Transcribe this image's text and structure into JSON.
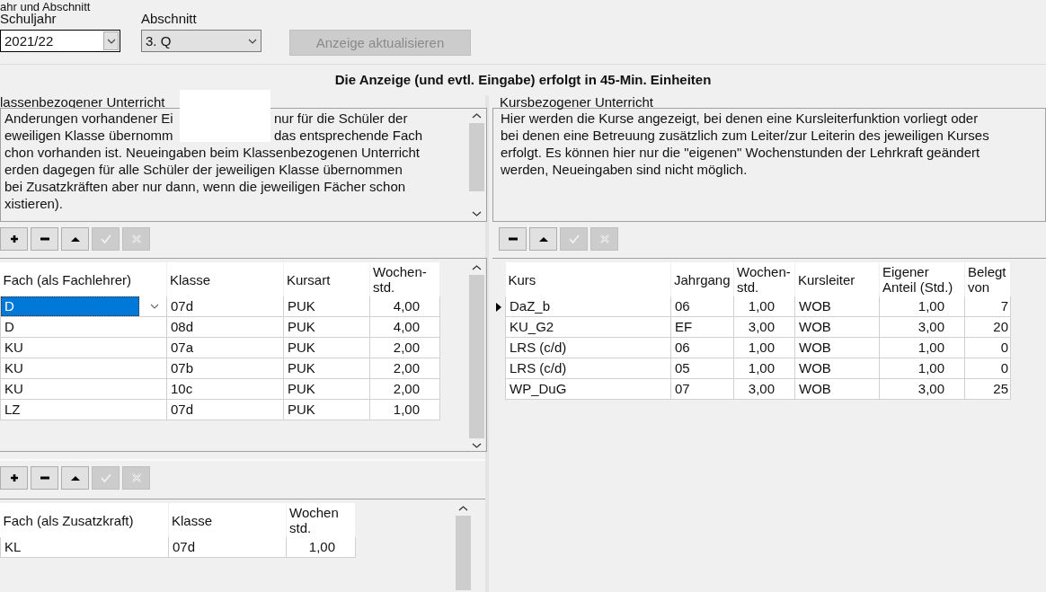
{
  "group_label": "ahr und Abschnitt",
  "fields": [
    {
      "label": "Schuljahr",
      "value": "2021/22",
      "focused": true
    },
    {
      "label": "Abschnitt",
      "value": "3. Q",
      "focused": false
    }
  ],
  "refresh_button": {
    "label": "Anzeige aktualisieren",
    "disabled": true
  },
  "heading": "Die Anzeige (und evtl. Eingabe) erfolgt in 45-Min. Einheiten",
  "class_panel": {
    "title": "lassenbezogener Unterricht",
    "description": [
      [
        "Anderungen vorhandener Ei",
        "nur für die Schüler der"
      ],
      [
        "eweiligen Klasse übernomm",
        "das entsprechende Fach"
      ],
      [
        "chon vorhanden ist. Neueingaben beim Klassenbezogenen Unterricht"
      ],
      [
        "erden dagegen für alle Schüler der jeweiligen Klasse übernommen"
      ],
      [
        "bei Zusatzkräften aber nur dann, wenn die jeweiligen Fächer schon"
      ],
      [
        "xistieren)."
      ]
    ],
    "toolbar": [
      {
        "kind": "plus",
        "disabled": false
      },
      {
        "kind": "minus",
        "disabled": false
      },
      {
        "kind": "up",
        "disabled": false
      },
      {
        "kind": "check",
        "disabled": true
      },
      {
        "kind": "cross",
        "disabled": true
      }
    ],
    "table": {
      "columns": [
        {
          "label": "Fach (als Fachlehrer)"
        },
        {
          "label": "Klasse"
        },
        {
          "label": "Kursart"
        },
        {
          "label": "Wochen-\nstd."
        }
      ],
      "rows": [
        {
          "cells": [
            "D",
            "07d",
            "PUK",
            "4,00"
          ],
          "selected": true
        },
        {
          "cells": [
            "D",
            "08d",
            "PUK",
            "4,00"
          ],
          "selected": false
        },
        {
          "cells": [
            "KU",
            "07a",
            "PUK",
            "2,00"
          ],
          "selected": false
        },
        {
          "cells": [
            "KU",
            "07b",
            "PUK",
            "2,00"
          ],
          "selected": false
        },
        {
          "cells": [
            "KU",
            "10c",
            "PUK",
            "2,00"
          ],
          "selected": false
        },
        {
          "cells": [
            "LZ",
            "07d",
            "PUK",
            "1,00"
          ],
          "selected": false
        }
      ]
    },
    "toolbar_2": [
      {
        "kind": "plus",
        "disabled": false
      },
      {
        "kind": "minus",
        "disabled": false
      },
      {
        "kind": "up",
        "disabled": false
      },
      {
        "kind": "check",
        "disabled": true
      },
      {
        "kind": "cross",
        "disabled": true
      }
    ],
    "table_2": {
      "columns": [
        {
          "label": "Fach (als Zusatzkraft)"
        },
        {
          "label": "Klasse"
        },
        {
          "label": "Wochen\nstd."
        }
      ],
      "rows": [
        {
          "cells": [
            "KL",
            "07d",
            "1,00"
          ],
          "selected": false
        }
      ]
    }
  },
  "course_panel": {
    "title": "Kursbezogener Unterricht",
    "description": [
      [
        "Hier werden die Kurse angezeigt, bei denen eine Kursleiterfunktion vorliegt oder"
      ],
      [
        "bei denen eine Betreuung zusätzlich zum Leiter/zur Leiterin des jeweiligen Kurses"
      ],
      [
        "erfolgt. Es können hier nur die \"eigenen\" Wochenstunden der Lehrkraft geändert"
      ],
      [
        "werden, Neueingaben sind nicht möglich."
      ]
    ],
    "toolbar": [
      {
        "kind": "minus",
        "disabled": false
      },
      {
        "kind": "up",
        "disabled": false
      },
      {
        "kind": "check",
        "disabled": true
      },
      {
        "kind": "cross",
        "disabled": true
      }
    ],
    "table": {
      "columns": [
        {
          "label": "Kurs"
        },
        {
          "label": "Jahrgang"
        },
        {
          "label": "Wochen-\nstd."
        },
        {
          "label": "Kursleiter"
        },
        {
          "label": "Eigener\nAnteil (Std.)"
        },
        {
          "label": "Belegt\nvon"
        }
      ],
      "rows": [
        {
          "cells": [
            "DaZ_b",
            "06",
            "1,00",
            "WOB",
            "1,00",
            "7"
          ],
          "selected": true
        },
        {
          "cells": [
            "KU_G2",
            "EF",
            "3,00",
            "WOB",
            "3,00",
            "20"
          ],
          "selected": false
        },
        {
          "cells": [
            "LRS (c/d)",
            "06",
            "1,00",
            "WOB",
            "1,00",
            "0"
          ],
          "selected": false
        },
        {
          "cells": [
            "LRS (c/d)",
            "05",
            "1,00",
            "WOB",
            "1,00",
            "0"
          ],
          "selected": false
        },
        {
          "cells": [
            "WP_DuG",
            "07",
            "3,00",
            "WOB",
            "3,00",
            "25"
          ],
          "selected": false
        }
      ]
    }
  }
}
